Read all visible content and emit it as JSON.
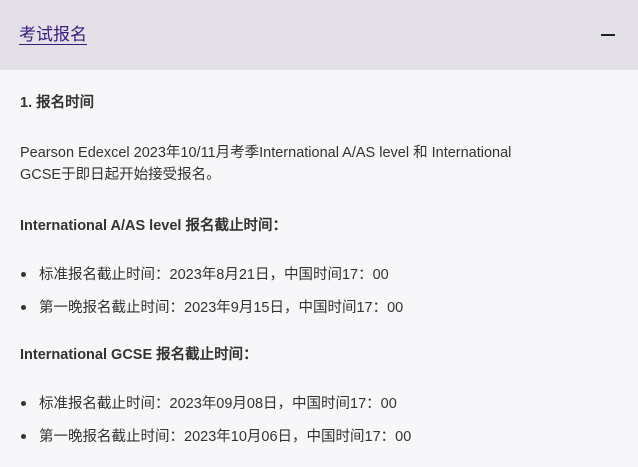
{
  "accordion": {
    "title": "考试报名",
    "toggle_icon": "minus-icon",
    "expanded": true,
    "colors": {
      "header_background": "#e4e0e8",
      "link": "#3a1d78",
      "body_background": "#f7f7f9"
    }
  },
  "content": {
    "section_heading": "1. 报名时间",
    "intro_lines": [
      "Pearson Edexcel 2023年10/11月考季International A/AS level 和 International",
      "GCSE于即日起开始接受报名。"
    ],
    "alevel": {
      "heading": "International A/AS level 报名截止时间：",
      "items": [
        "标准报名截止时间：2023年8月21日，中国时间17：00",
        "第一晚报名截止时间：2023年9月15日，中国时间17：00"
      ]
    },
    "igcse": {
      "heading": "International GCSE 报名截止时间：",
      "items": [
        "标准报名截止时间：2023年09月08日，中国时间17：00",
        "第一晚报名截止时间：2023年10月06日，中国时间17：00"
      ]
    }
  }
}
